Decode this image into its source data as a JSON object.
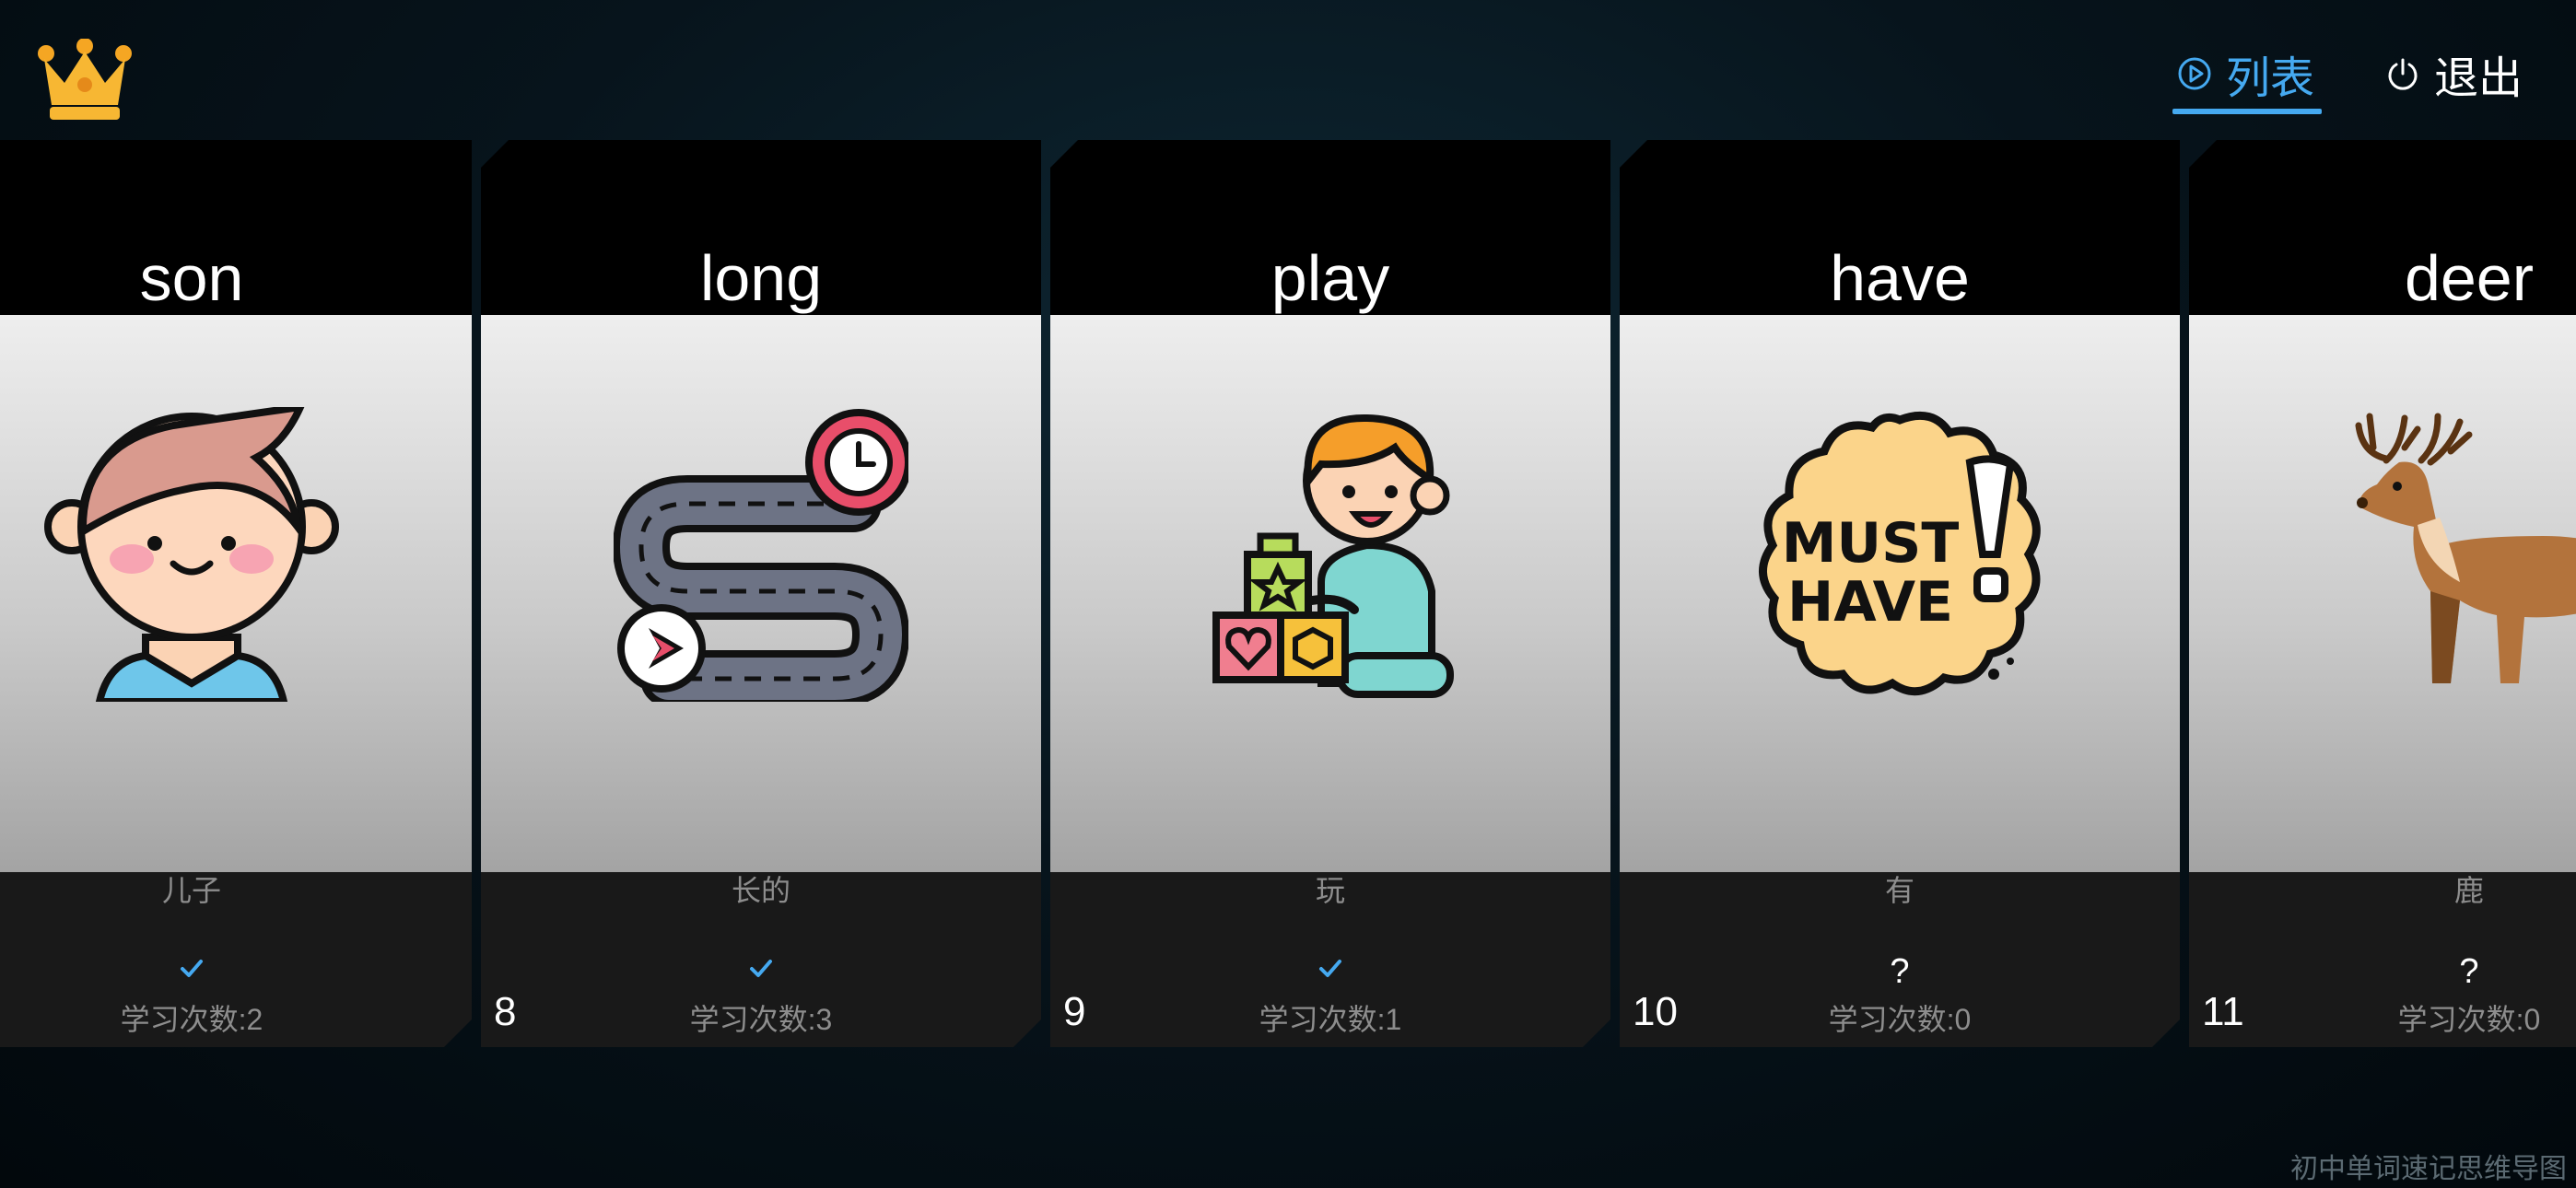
{
  "header": {
    "logo_icon": "crown-icon",
    "list_label": "列表",
    "list_icon": "play-circle-icon",
    "exit_label": "退出",
    "exit_icon": "power-icon",
    "accent_color": "#45a9f0"
  },
  "cards": [
    {
      "word": "son",
      "meaning": "儿子",
      "index": "",
      "status": "check",
      "count": "学习次数:2",
      "image_icon": "boy-face-icon"
    },
    {
      "word": "long",
      "meaning": "长的",
      "index": "8",
      "status": "check",
      "count": "学习次数:3",
      "image_icon": "winding-road-icon"
    },
    {
      "word": "play",
      "meaning": "玩",
      "index": "9",
      "status": "check",
      "count": "学习次数:1",
      "image_icon": "child-playing-blocks-icon"
    },
    {
      "word": "have",
      "meaning": "有",
      "index": "10",
      "status": "?",
      "count": "学习次数:0",
      "image_icon": "must-have-badge-icon"
    },
    {
      "word": "deer",
      "meaning": "鹿",
      "index": "11",
      "status": "?",
      "count": "学习次数:0",
      "image_icon": "deer-icon"
    }
  ],
  "footer": {
    "watermark": "初中单词速记思维导图"
  }
}
